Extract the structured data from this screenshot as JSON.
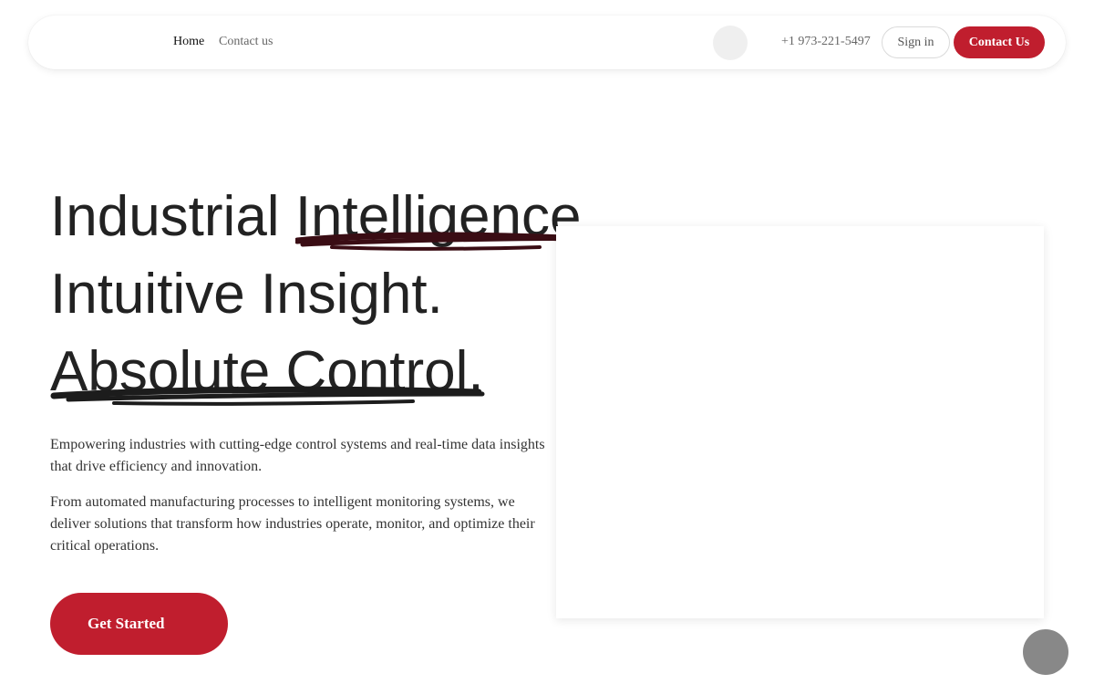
{
  "nav": {
    "links": [
      {
        "label": "Home"
      },
      {
        "label": "Contact us"
      }
    ],
    "phone": "+1 973-221-5497",
    "signin_label": "Sign in",
    "contact_label": "Contact Us"
  },
  "hero": {
    "line1_before": "Industrial ",
    "line1_highlight": "Intelligence",
    "line1_after": ".",
    "line2": "Intuitive Insight.",
    "line3_highlight": "Absolute Control",
    "line3_after": ".",
    "paragraph1": "Empowering industries with cutting-edge control systems and real-time data insights that drive efficiency and innovation.",
    "paragraph2": "From automated manufacturing processes to intelligent monitoring systems, we deliver solutions that transform how industries operate, monitor, and optimize their critical operations.",
    "cta_label": "Get Started"
  },
  "colors": {
    "accent": "#c01e2e",
    "scribble_dark_red": "#3a0d14",
    "scribble_black": "#1c1c1c"
  },
  "icons": {
    "theme_toggle": "theme-toggle-icon",
    "chat": "chat-bubble-icon"
  }
}
